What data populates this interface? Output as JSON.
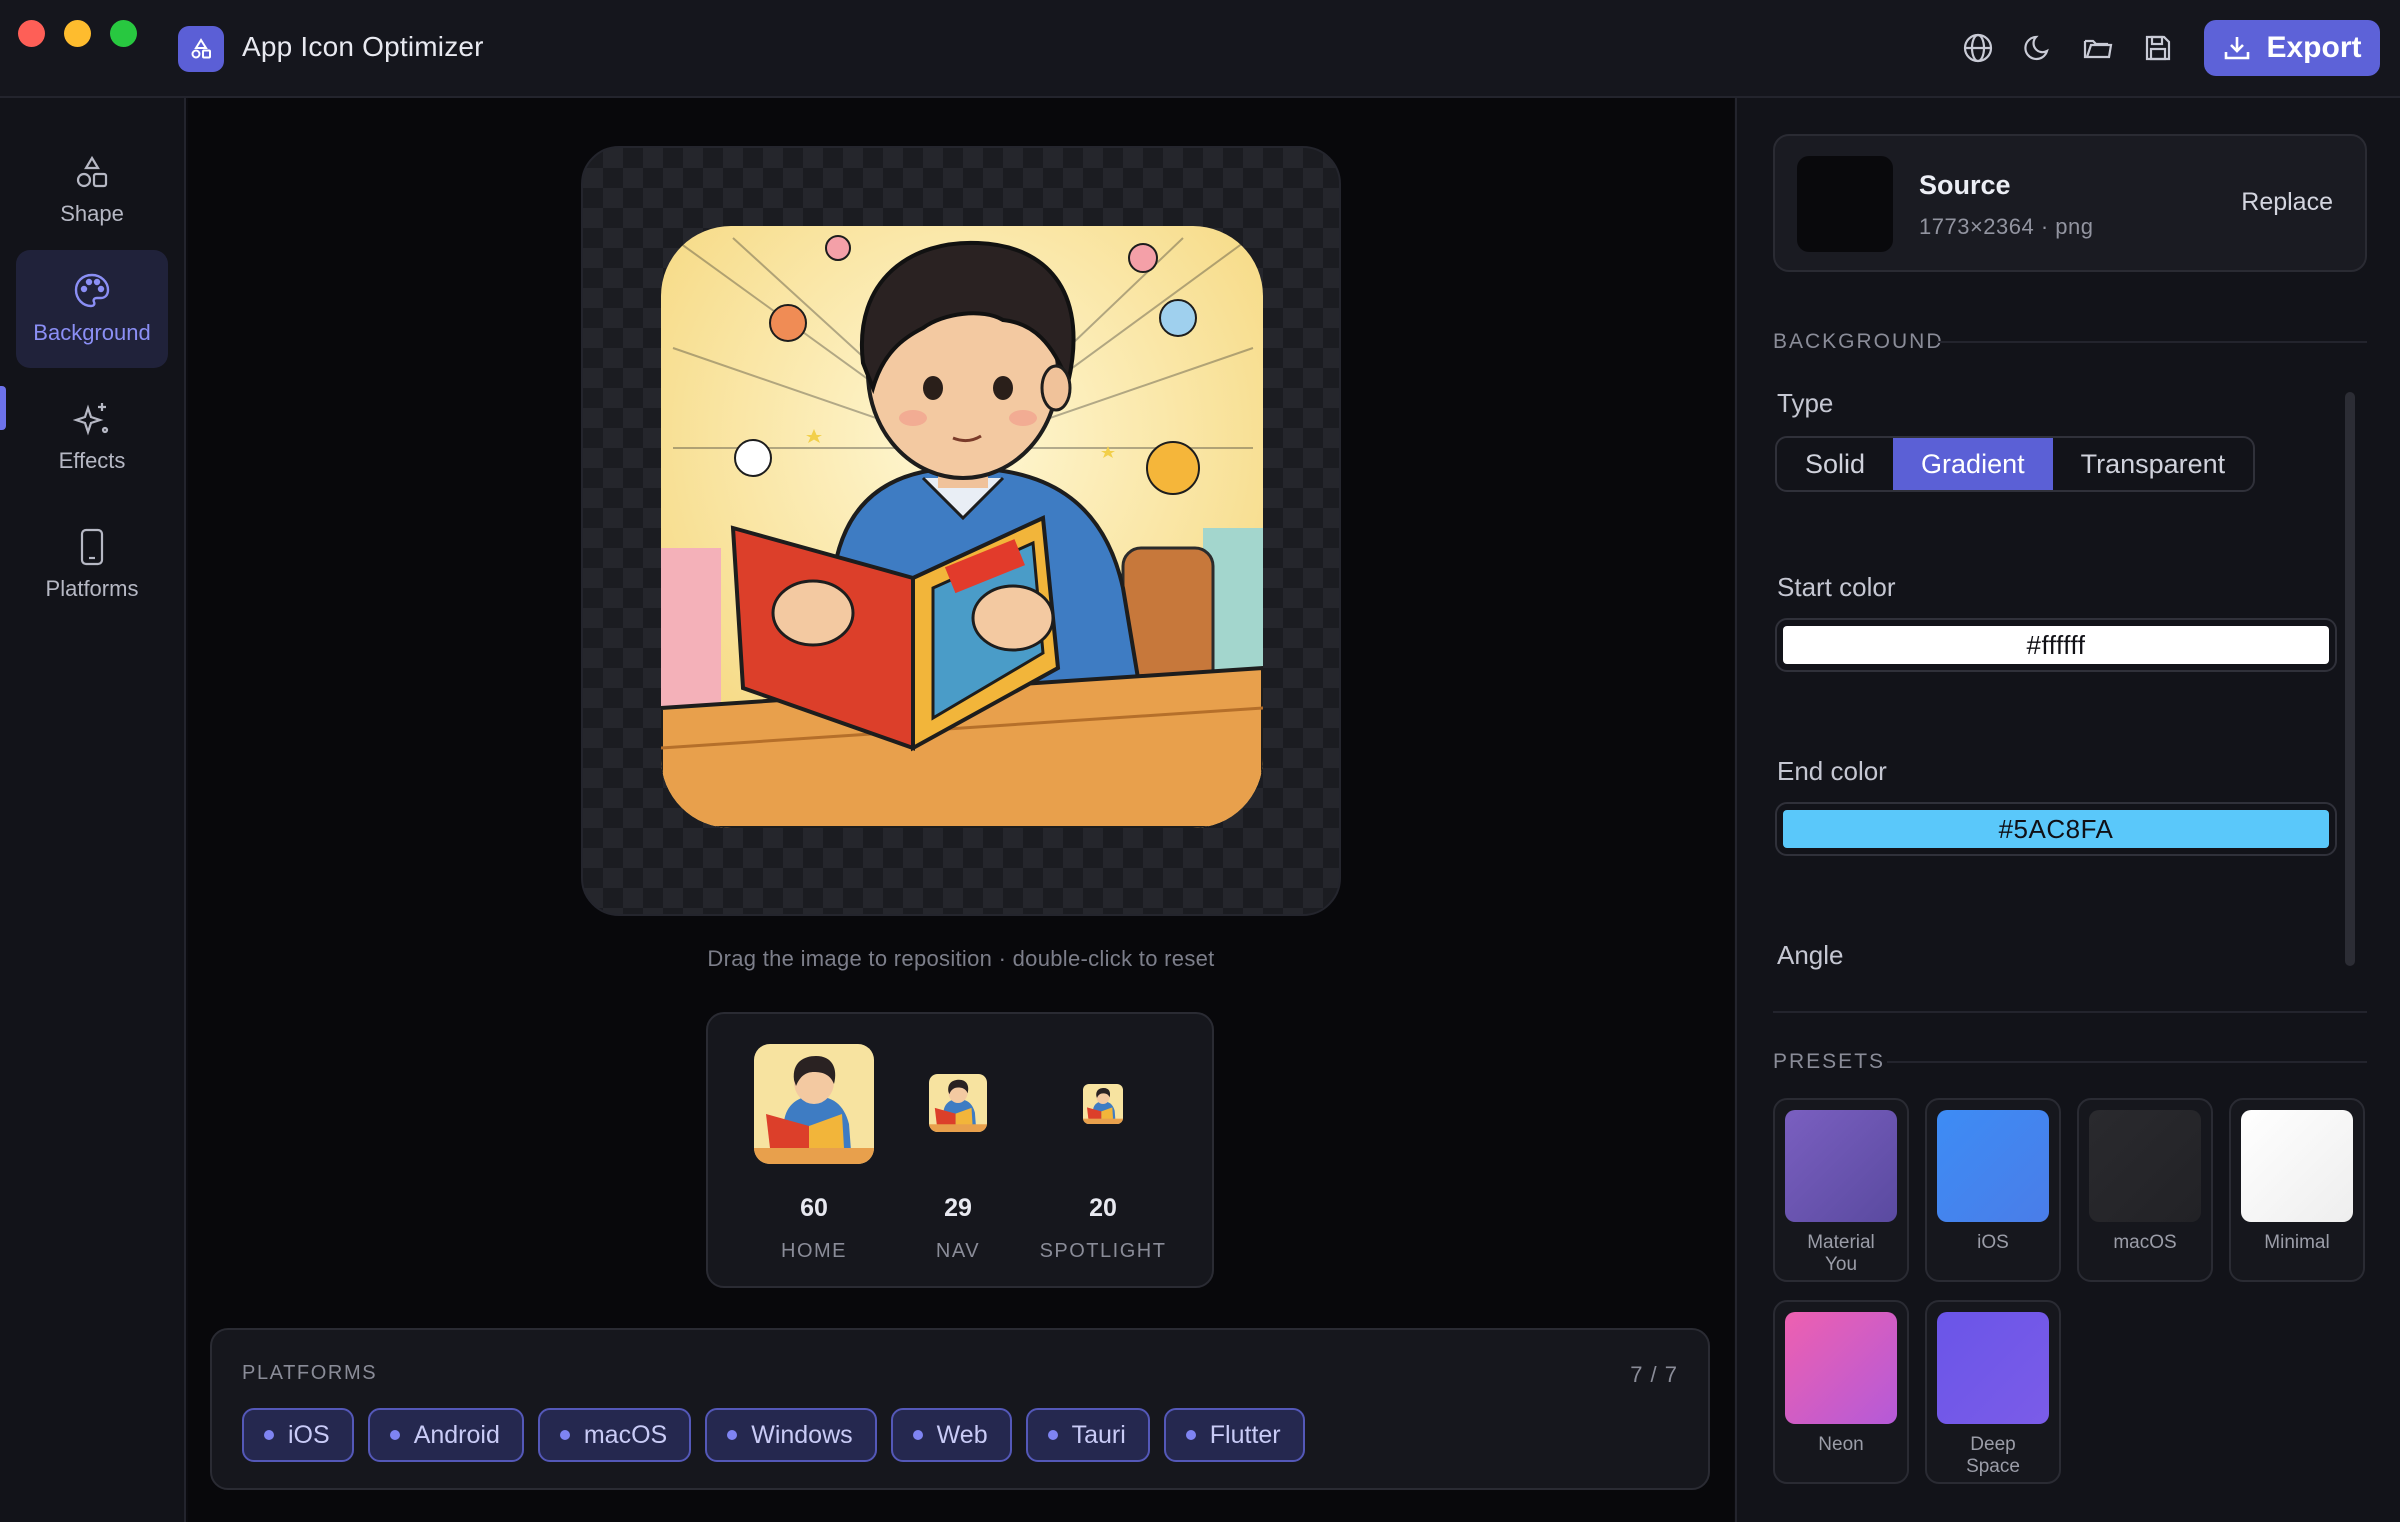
{
  "window": {
    "title": "App Icon Optimizer",
    "export_label": "Export"
  },
  "toolbar_icons": [
    "globe-icon",
    "moon-icon",
    "folder-icon",
    "save-icon"
  ],
  "sidebar": {
    "items": [
      {
        "label": "Shape",
        "icon": "shapes-icon",
        "active": false
      },
      {
        "label": "Background",
        "icon": "palette-icon",
        "active": true
      },
      {
        "label": "Effects",
        "icon": "sparkles-icon",
        "active": false
      },
      {
        "label": "Platforms",
        "icon": "device-icon",
        "active": false
      }
    ]
  },
  "canvas": {
    "hint": "Drag the image to reposition · double-click to reset"
  },
  "previews": [
    {
      "size": "60",
      "label": "HOME"
    },
    {
      "size": "29",
      "label": "NAV"
    },
    {
      "size": "20",
      "label": "SPOTLIGHT"
    }
  ],
  "platforms": {
    "title": "PLATFORMS",
    "count": "7 / 7",
    "chips": [
      "iOS",
      "Android",
      "macOS",
      "Windows",
      "Web",
      "Tauri",
      "Flutter"
    ]
  },
  "source": {
    "title": "Source",
    "meta": "1773×2364 · png",
    "replace_label": "Replace"
  },
  "background": {
    "section_label": "BACKGROUND",
    "type_label": "Type",
    "types": [
      "Solid",
      "Gradient",
      "Transparent"
    ],
    "active_type": "Gradient",
    "start_color_label": "Start color",
    "start_color": "#ffffff",
    "end_color_label": "End color",
    "end_color": "#5AC8FA",
    "angle_label": "Angle"
  },
  "presets": {
    "section_label": "PRESETS",
    "items": [
      {
        "line1": "Material",
        "line2": "You",
        "from": "#7a5fc0",
        "to": "#5a4aa0"
      },
      {
        "line1": "iOS",
        "line2": "",
        "from": "#3d8cf5",
        "to": "#4a7de8"
      },
      {
        "line1": "macOS",
        "line2": "",
        "from": "#2a2a2e",
        "to": "#222226"
      },
      {
        "line1": "Minimal",
        "line2": "",
        "from": "#ffffff",
        "to": "#eeeeee"
      },
      {
        "line1": "Neon",
        "line2": "",
        "from": "#ee60b0",
        "to": "#b45ad8"
      },
      {
        "line1": "Deep",
        "line2": "Space",
        "from": "#6a55e8",
        "to": "#7b5ce8"
      }
    ]
  }
}
